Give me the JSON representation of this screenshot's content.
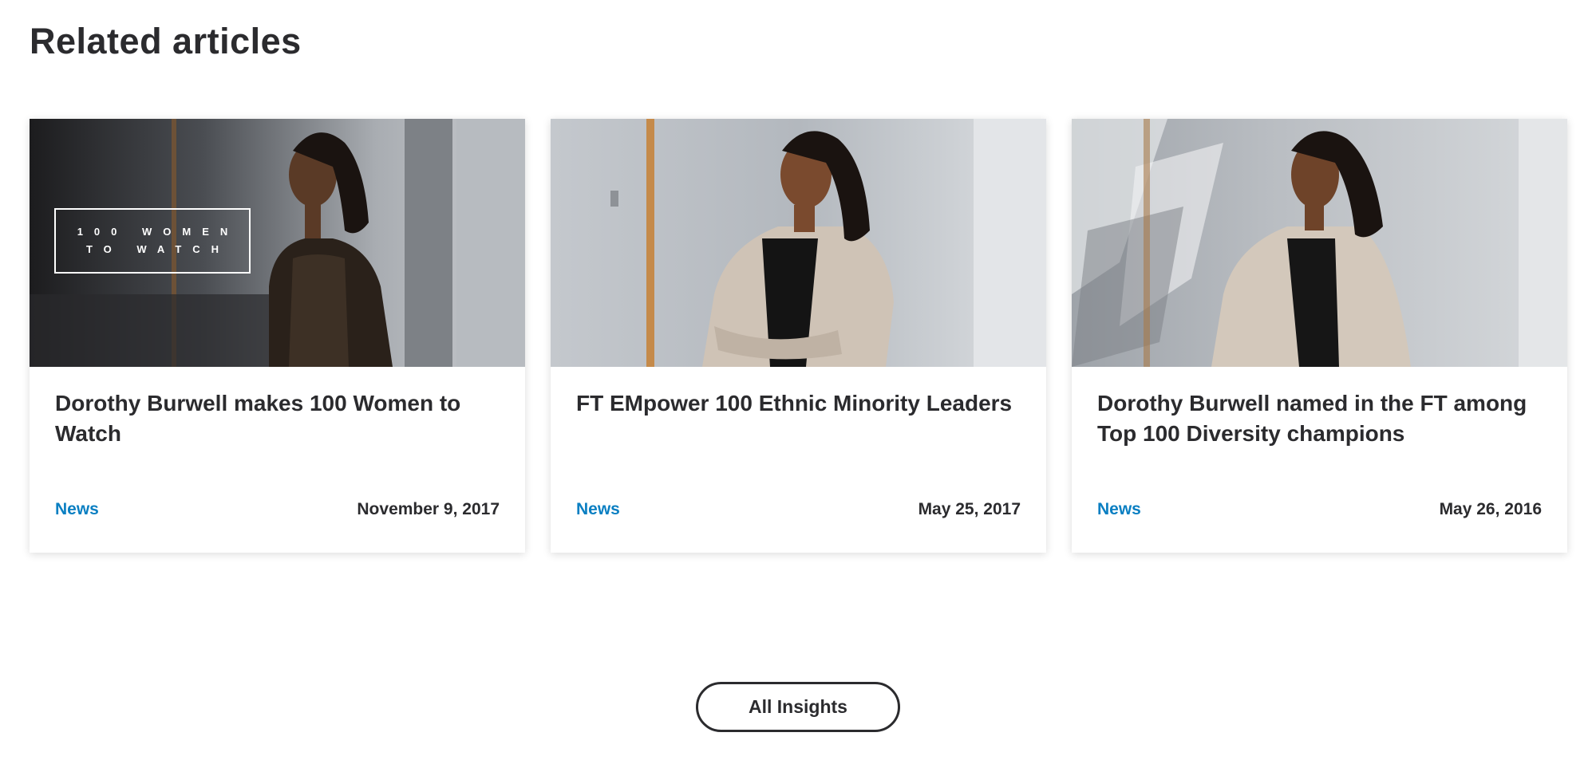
{
  "section": {
    "title": "Related articles"
  },
  "articles": [
    {
      "title": "Dorothy Burwell makes 100 Women to Watch",
      "category": "News",
      "date": "November 9, 2017",
      "badge_line1": "100 WOMEN",
      "badge_line2": "TO WATCH"
    },
    {
      "title": "FT EMpower 100 Ethnic Minority Leaders",
      "category": "News",
      "date": "May 25, 2017"
    },
    {
      "title": "Dorothy Burwell named in the FT among Top 100 Diversity champions",
      "category": "News",
      "date": "May 26, 2016"
    }
  ],
  "footer": {
    "all_insights_label": "All Insights"
  },
  "colors": {
    "accent": "#0a7fc2",
    "text": "#2b2b2e"
  }
}
